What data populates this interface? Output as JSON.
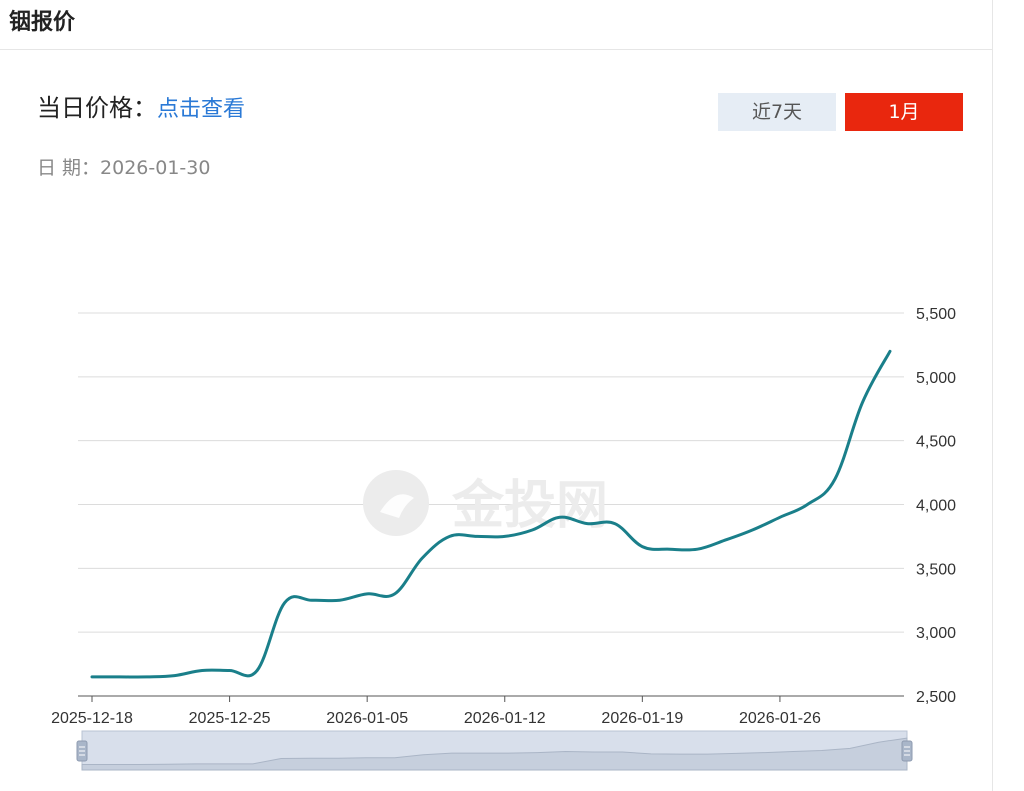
{
  "page": {
    "title": "铟报价"
  },
  "price": {
    "label": "当日价格：",
    "link": "点击查看"
  },
  "date": {
    "label": "日 期：",
    "value": "2026-01-30"
  },
  "range_buttons": {
    "week": "近7天",
    "month": "1月",
    "active": "month"
  },
  "watermark": "金投网",
  "colors": {
    "line": "#1a7f8a",
    "grid": "#dcdcdc",
    "active_button": "#e9270e",
    "inactive_button": "#e6edf5",
    "link": "#2a79d6",
    "slider_fill": "#d8dfeb"
  },
  "chart_data": {
    "type": "line",
    "ylim": [
      2500,
      5500
    ],
    "yticks": [
      2500,
      3000,
      3500,
      4000,
      4500,
      5000,
      5500
    ],
    "ytick_labels": [
      "2,500",
      "3,000",
      "3,500",
      "4,000",
      "4,500",
      "5,000",
      "5,500"
    ],
    "y_axis_position": "right",
    "grid": true,
    "x_tick_labels": [
      "2025-12-18",
      "2025-12-25",
      "2026-01-05",
      "2026-01-12",
      "2026-01-19",
      "2026-01-26"
    ],
    "x_tick_indices": [
      0,
      5,
      10,
      15,
      20,
      25
    ],
    "series": [
      {
        "name": "",
        "x": [
          "2025-12-18",
          "2025-12-19",
          "2025-12-22",
          "2025-12-23",
          "2025-12-24",
          "2025-12-25",
          "2025-12-26",
          "2025-12-29",
          "2025-12-30",
          "2025-12-31",
          "2026-01-05",
          "2026-01-06",
          "2026-01-07",
          "2026-01-08",
          "2026-01-09",
          "2026-01-12",
          "2026-01-13",
          "2026-01-14",
          "2026-01-15",
          "2026-01-16",
          "2026-01-19",
          "2026-01-20",
          "2026-01-21",
          "2026-01-22",
          "2026-01-23",
          "2026-01-26",
          "2026-01-27",
          "2026-01-28",
          "2026-01-29",
          "2026-01-30"
        ],
        "values": [
          2650,
          2650,
          2650,
          2660,
          2700,
          2700,
          2700,
          3230,
          3250,
          3250,
          3300,
          3300,
          3580,
          3750,
          3750,
          3750,
          3800,
          3900,
          3850,
          3850,
          3670,
          3650,
          3650,
          3720,
          3800,
          3900,
          4000,
          4200,
          4800,
          5200
        ]
      }
    ]
  }
}
